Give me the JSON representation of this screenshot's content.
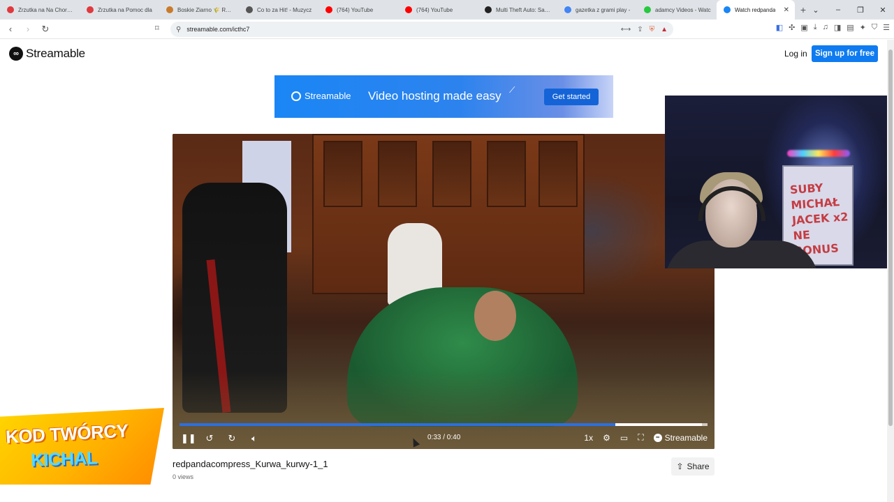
{
  "browser": {
    "tabs": [
      {
        "label": "Zrzutka na Na Chore O",
        "fav_color": "#e0393e"
      },
      {
        "label": "Zrzutka na Pomoc dla",
        "fav_color": "#e0393e"
      },
      {
        "label": "Boskie Ziarno 🌾 Reko",
        "fav_color": "#c97b2b"
      },
      {
        "label": "Co to za Hit! - Muzycz",
        "fav_color": "#555555"
      },
      {
        "label": "(764) YouTube",
        "fav_color": "#ff0000"
      },
      {
        "label": "(764) YouTube",
        "fav_color": "#ff0000"
      },
      {
        "label": "Multi Theft Auto: San A",
        "fav_color": "#222222"
      },
      {
        "label": "gazetka z grami play -",
        "fav_color": "#4285f4"
      },
      {
        "label": "adamcy Videos - Watc",
        "fav_color": "#27c93f"
      },
      {
        "label": "Watch redpanda",
        "fav_color": "#1a86f5",
        "active": true
      }
    ],
    "url": "streamable.com/icthc7",
    "icons": {
      "back": "arrow-left-icon",
      "forward": "arrow-right-icon",
      "reload": "reload-icon",
      "bookmark": "bookmark-icon",
      "site_info": "site-info-icon"
    }
  },
  "site": {
    "brand": "Streamable",
    "login_label": "Log in",
    "signup_label": "Sign up for free"
  },
  "banner": {
    "brand": "Streamable",
    "tagline": "Video hosting made easy",
    "cta": "Get started"
  },
  "player": {
    "time_current": "0:33",
    "time_total": "0:40",
    "time_display": "0:33 / 0:40",
    "progress_fraction": 0.825,
    "buffered_fraction": 0.99,
    "speed_label": "1x",
    "watermark": "Streamable",
    "state": "playing"
  },
  "overlay": {
    "whiteboard_text": [
      "SUBY",
      "MICHAŁ",
      "JACEK x2",
      "NE",
      "BONUS"
    ],
    "promo_line1": "KOD TWÓRCY",
    "promo_line2": "KICHAL"
  },
  "video_meta": {
    "title": "redpandacompress_Kurwa_kurwy-1_1",
    "views": "0 views",
    "share_label": "Share"
  },
  "colors": {
    "accent": "#0f7bf0",
    "progress": "#2c6fe0",
    "promo": "#ffb300"
  }
}
